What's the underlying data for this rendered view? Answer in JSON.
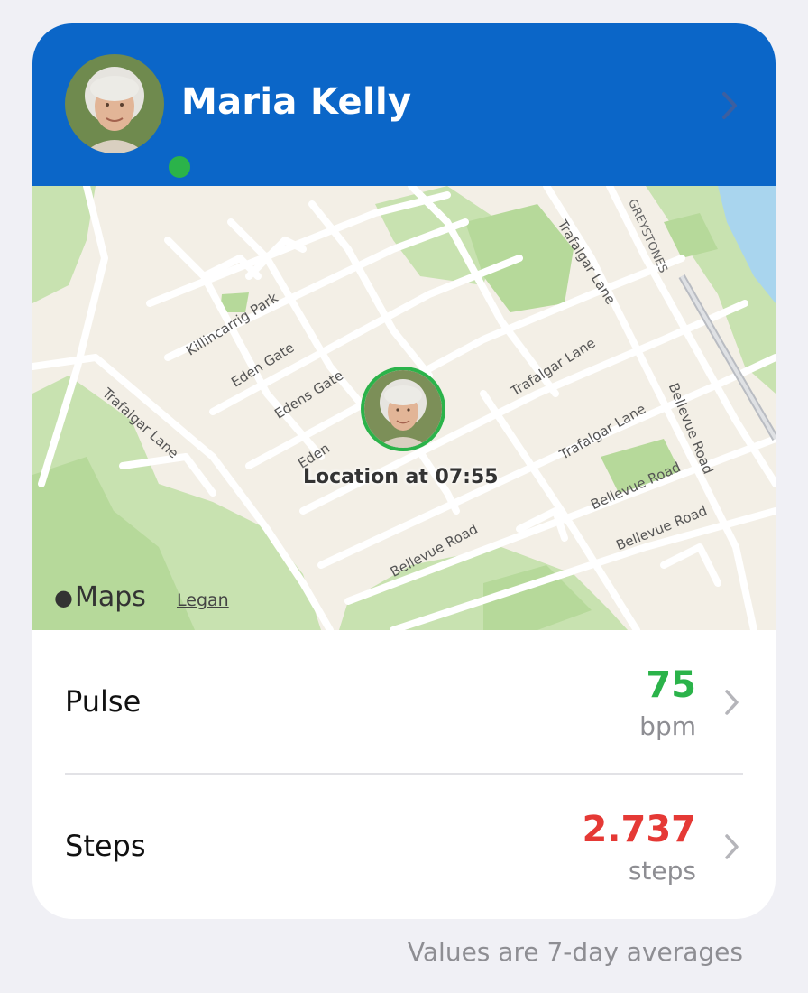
{
  "contact": {
    "name": "Maria Kelly",
    "avatar_icon": "person-portrait-icon",
    "status": "online",
    "status_color": "#2bb34a"
  },
  "colors": {
    "header": "#0b66c8",
    "pulse_value": "#2bb34a",
    "steps_value": "#e53935",
    "muted": "#8e8e93"
  },
  "map": {
    "caption": "Location at 07:55",
    "brand": "Maps",
    "legal": "Legan",
    "street_labels": {
      "killincarrig": "Killincarrig Park",
      "eden_gate": "Eden Gate",
      "edens_gate": "Edens Gate",
      "eden_partial": "Eden",
      "trafalgar_left": "Trafalgar Lane",
      "trafalgar_top": "Trafalgar Lane",
      "trafalgar_mid": "Trafalgar Lane",
      "trafalgar_right": "Trafalgar Lane",
      "greystones": "GREYSTONES",
      "bellevue_vertical": "Bellevue Road",
      "bellevue_1": "Bellevue Road",
      "bellevue_2": "Bellevue Road",
      "bellevue_bottom": "Bellevue Road"
    }
  },
  "metrics": {
    "pulse": {
      "label": "Pulse",
      "value": "75",
      "unit": "bpm"
    },
    "steps": {
      "label": "Steps",
      "value": "2.737",
      "unit": "steps"
    }
  },
  "footnote": "Values are 7-day averages"
}
